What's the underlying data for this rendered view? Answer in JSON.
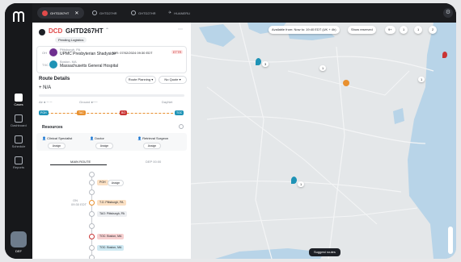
{
  "colors": {
    "accent": "#e04a4a",
    "chip_blue": "#1e93b6",
    "chip_orange": "#e8902f",
    "chip_red": "#c93434",
    "map_road": "#f4f5f6",
    "map_water": "#b8d4e8"
  },
  "tabs": [
    {
      "label": "GHTD267HT",
      "active": true,
      "icon": "red-dot-icon"
    },
    {
      "label": "GHTD27HR",
      "active": false,
      "icon": "circle-icon"
    },
    {
      "label": "GHTD27HR",
      "active": false,
      "icon": "circle-icon"
    },
    {
      "label": "HUANERU",
      "active": false,
      "icon": "plane-icon"
    }
  ],
  "sidebar": {
    "items": [
      {
        "label": "Cases",
        "icon": "cases-icon",
        "active": true
      },
      {
        "label": "Dashboard",
        "icon": "grid-icon",
        "active": false
      },
      {
        "label": "Schedule",
        "icon": "calendar-icon",
        "active": false
      },
      {
        "label": "Reports",
        "icon": "document-icon",
        "active": false
      }
    ],
    "user": "DEF"
  },
  "case": {
    "type": "DCD",
    "id": "GHTD267HT",
    "status": "Pending Logistics",
    "origin_city": "Pittsburgh, PA",
    "origin_name": "UPMC Presbyterian Shadyside",
    "or_label": "OR: 07/02/2024 09:30 EDT",
    "or_badge": "ETTR",
    "dest_city": "Boston, MA",
    "dest_name": "Massachusetts General Hospital"
  },
  "route": {
    "title": "Route Details",
    "planning": "Route Planning",
    "quote": "No Quote",
    "mode": "N/A",
    "air_label": "Air",
    "ground_label": "Ground",
    "dayjet_label": "DayNet",
    "stops": [
      "PGH",
      "TAC",
      "BO",
      "TOC"
    ]
  },
  "resources": {
    "title": "Resources",
    "items": [
      {
        "label": "Clinical Specialist",
        "button": "Assign"
      },
      {
        "label": "Doctor",
        "button": "Assign"
      },
      {
        "label": "Retrieval Surgeon",
        "button": "Assign"
      }
    ]
  },
  "timeline": {
    "tabs": [
      "MAIN ROUTE",
      "DEP 00:00"
    ],
    "date_line1": "ON",
    "date_line2": "09:30 EDT",
    "assign_button": "Assign",
    "tags": [
      {
        "label": "PGH",
        "color": "#e8902f"
      },
      {
        "label": "T.O. Pittsburgh, PA",
        "color": "#e8902f"
      },
      {
        "label": "TAO: Pittsburgh, PA",
        "color": "#d5d9de"
      },
      {
        "label": "TOC: Boston, MA",
        "color": "#c93434"
      },
      {
        "label": "TOC: Boston, MA",
        "color": "#1e93b6"
      }
    ]
  },
  "map": {
    "available_label": "Available from: Now  to: 19:40 EDT (UK + 4h)",
    "show_reserved": "Show reserved",
    "pills": [
      "9+",
      "1",
      "1",
      "2"
    ],
    "suggest_button": "Suggest routes",
    "markers": [
      "3",
      "1",
      "1",
      "1",
      "1"
    ]
  }
}
